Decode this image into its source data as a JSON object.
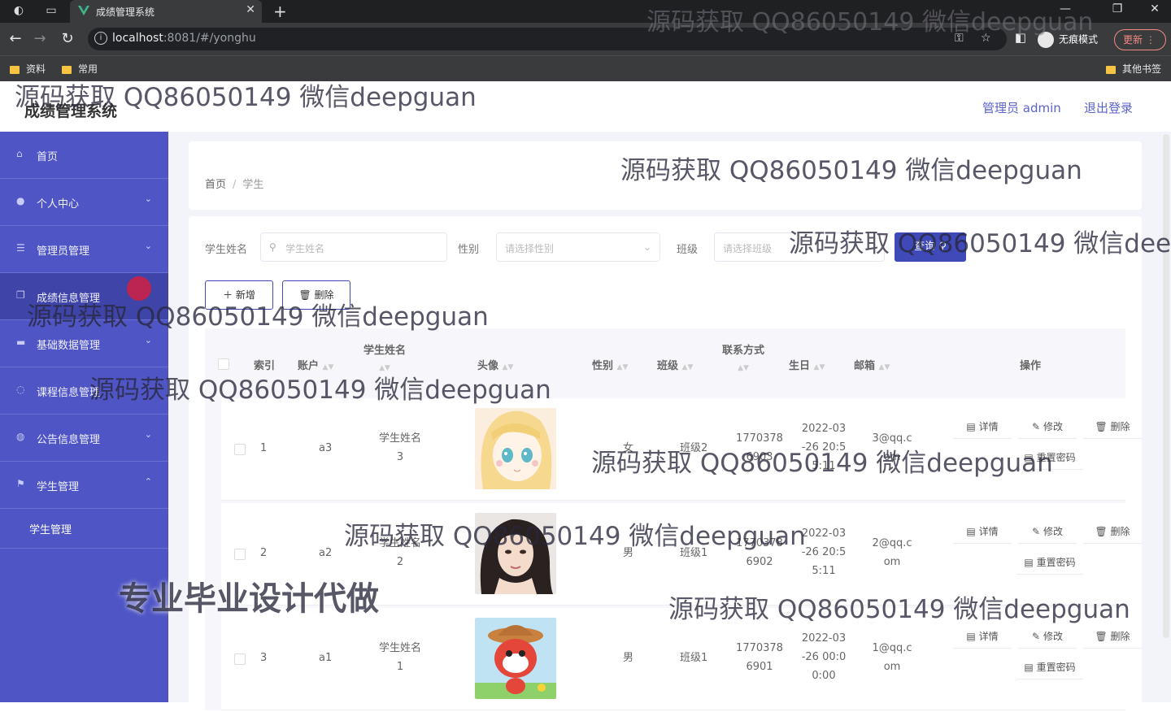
{
  "browser": {
    "tab_title": "成绩管理系统",
    "url_host": "localhost",
    "url_path": ":8081/#/yonghu",
    "incognito_label": "无痕模式",
    "update_label": "更新",
    "bookmarks": [
      "资料",
      "常用"
    ],
    "other_bookmarks": "其他书签"
  },
  "header": {
    "title": "成绩管理系统",
    "user": "管理员 admin",
    "logout": "退出登录"
  },
  "sidebar": {
    "items": [
      {
        "label": "首页",
        "icon": "home-icon"
      },
      {
        "label": "个人中心",
        "icon": "user-icon"
      },
      {
        "label": "管理员管理",
        "icon": "list-icon"
      },
      {
        "label": "成绩信息管理",
        "icon": "copy-icon"
      },
      {
        "label": "基础数据管理",
        "icon": "screen-icon"
      },
      {
        "label": "课程信息管理",
        "icon": "power-icon"
      },
      {
        "label": "公告信息管理",
        "icon": "globe-icon"
      },
      {
        "label": "学生管理",
        "icon": "flag-icon"
      }
    ],
    "submenu": "学生管理"
  },
  "breadcrumb": {
    "home": "首页",
    "sep": "/",
    "current": "学生"
  },
  "filters": {
    "name_label": "学生姓名",
    "name_placeholder": "学生姓名",
    "gender_label": "性别",
    "gender_placeholder": "请选择性别",
    "class_label": "班级",
    "class_placeholder": "请选择班级",
    "query": "查询"
  },
  "actions": {
    "add": "新增",
    "delete": "删除"
  },
  "table": {
    "headers": {
      "index": "索引",
      "account": "账户",
      "name": "学生姓名",
      "avatar": "头像",
      "gender": "性别",
      "class": "班级",
      "contact": "联系方式",
      "birthday": "生日",
      "email": "邮箱",
      "ops": "操作"
    },
    "rows": [
      {
        "index": "1",
        "account": "a3",
        "name1": "学生姓名",
        "name2": "3",
        "gender": "女",
        "class": "班级2",
        "phone1": "1770378",
        "phone2": "6903",
        "bday1": "2022-03",
        "bday2": "-26 20:5",
        "bday3": "5:11",
        "email1": "3@qq.c",
        "email2": "om"
      },
      {
        "index": "2",
        "account": "a2",
        "name1": "学生姓名",
        "name2": "2",
        "gender": "男",
        "class": "班级1",
        "phone1": "1770378",
        "phone2": "6902",
        "bday1": "2022-03",
        "bday2": "-26 20:5",
        "bday3": "5:11",
        "email1": "2@qq.c",
        "email2": "om"
      },
      {
        "index": "3",
        "account": "a1",
        "name1": "学生姓名",
        "name2": "1",
        "gender": "男",
        "class": "班级1",
        "phone1": "1770378",
        "phone2": "6901",
        "bday1": "2022-03",
        "bday2": "-26 00:0",
        "bday3": "0:00",
        "email1": "1@qq.c",
        "email2": "om"
      }
    ],
    "op_labels": {
      "detail": "详情",
      "edit": "修改",
      "remove": "删除",
      "reset": "重置密码"
    }
  },
  "watermarks": {
    "qq": "源码获取 QQ86050149 微信deepguan",
    "promo": "专业毕业设计代做"
  }
}
